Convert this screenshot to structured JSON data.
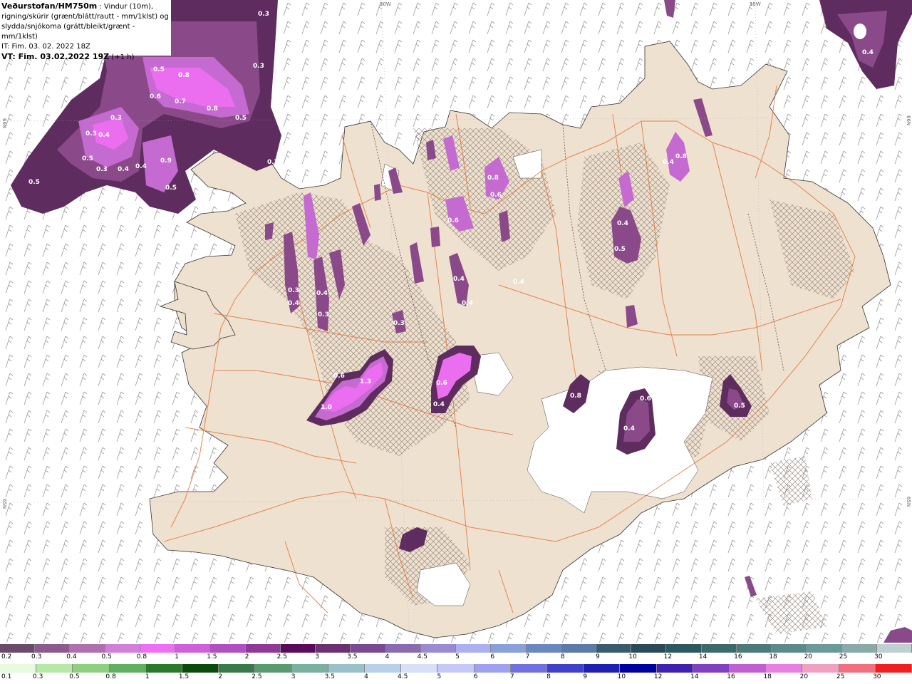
{
  "header": {
    "source": "Veðurstofan/HM750m",
    "desc1": " : Vindur (10m),",
    "desc2": "rigning/skúrir (grænt/blátt/rautt - mm/1klst) og",
    "desc3": "slydda/snjókoma (grátt/bleikt/grænt - mm/1klst)",
    "it": "IT: Fim. 03. 02. 2022 18Z",
    "vt_label": "VT: Fim. 03.02.2022 19Z",
    "vt_offset": " (+1 h)"
  },
  "grid_labels": {
    "top_20w": "20W",
    "top_15w": "15W",
    "left_66n": "66N",
    "left_65n": "65N",
    "right_66n": "66N",
    "right_65n": "65N"
  },
  "colors": {
    "land": "#efe1d0",
    "snow_dark": "#5e2c5e",
    "snow_mid": "#8a4a8a",
    "snow_light": "#c56ad0",
    "snow_bright": "#ec6ef0",
    "roads": "#e2743a",
    "sea": "#ffffff"
  },
  "snow_scale": {
    "ticks": [
      "0.2",
      "0.3",
      "0.4",
      "0.5",
      "0.8",
      "1",
      "1.5",
      "2",
      "2.5",
      "3",
      "3.5",
      "4",
      "4.5",
      "5",
      "6",
      "7",
      "8",
      "9",
      "10",
      "12",
      "14",
      "16",
      "18",
      "20",
      "25",
      "30"
    ],
    "colors": [
      "#6b4a6b",
      "#8e5a8e",
      "#b070b0",
      "#d080d8",
      "#ee70f2",
      "#d060d8",
      "#b050c0",
      "#903898",
      "#5a0a5a",
      "#6a3070",
      "#7a4a90",
      "#8a6ab0",
      "#9a8ad0",
      "#aab0f0",
      "#8aa0d8",
      "#6a88c0",
      "#5a7aa8",
      "#3a5a70",
      "#2a4a5a",
      "#2a5a60",
      "#3a6a6a",
      "#4a7a7a",
      "#5a8a8a",
      "#6a9a9a",
      "#8aaaaa",
      "#c0d0d0"
    ]
  },
  "rain_scale": {
    "ticks": [
      "0.1",
      "0.3",
      "0.5",
      "0.8",
      "1",
      "1.5",
      "2",
      "2.5",
      "3",
      "3.5",
      "4",
      "4.5",
      "5",
      "6",
      "7",
      "8",
      "9",
      "10",
      "12",
      "14",
      "16",
      "18",
      "20",
      "25",
      "30"
    ],
    "colors": [
      "#e8fbe0",
      "#b8e8a8",
      "#8fd080",
      "#60b060",
      "#2a7a2a",
      "#0a4a0a",
      "#3a7a4a",
      "#5a9a70",
      "#7ab0a0",
      "#9ac0c8",
      "#b8d0e8",
      "#d8e0f8",
      "#c8c8f8",
      "#a0a0f0",
      "#7070e0",
      "#4040c8",
      "#2020b0",
      "#0000a0",
      "#4020b0",
      "#8040c0",
      "#c060d0",
      "#e880e0",
      "#f0a0c0",
      "#f07080",
      "#f02020"
    ]
  },
  "map_labels": [
    "0.3",
    "0.3",
    "0.5",
    "0.8",
    "0.6",
    "0.7",
    "0.8",
    "0.3",
    "0.5",
    "0.3",
    "0.4",
    "0.9",
    "0.5",
    "0.4",
    "0.3",
    "0.7",
    "0.5",
    "0.4",
    "0.5",
    "0.6",
    "0.4",
    "0.8",
    "0.6",
    "1.3",
    "1.0",
    "0.6",
    "0.4",
    "0.4",
    "0.4",
    "0.4",
    "0.5",
    "0.4",
    "0.3",
    "0.3",
    "0.6",
    "0.8",
    "0.6",
    "0.4",
    "0.8",
    "0.4",
    "0.3",
    "0.5",
    "0.4",
    "0.4"
  ]
}
